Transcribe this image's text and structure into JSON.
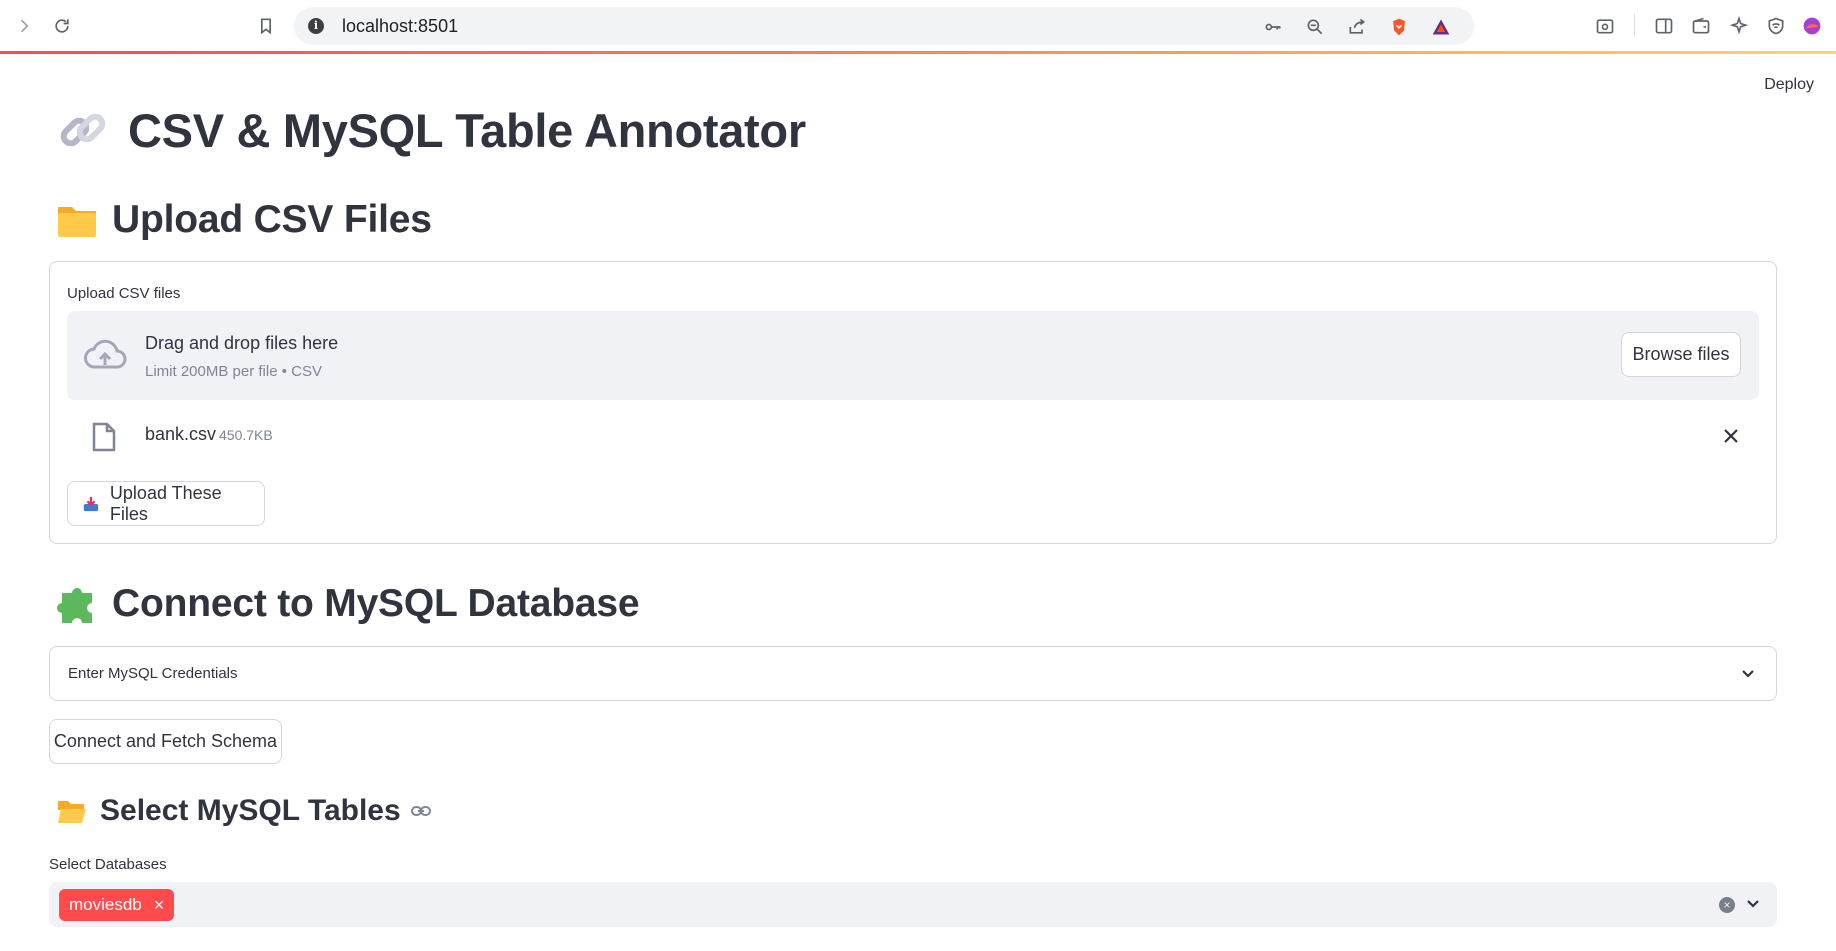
{
  "browser": {
    "url": "localhost:8501"
  },
  "app": {
    "deploy_label": "Deploy",
    "title": "CSV & MySQL Table Annotator",
    "title_icon": "link-emoji"
  },
  "upload_section": {
    "heading": "Upload CSV Files",
    "heading_icon": "folder-emoji",
    "uploader_label": "Upload CSV files",
    "dropzone_title": "Drag and drop files here",
    "dropzone_limit": "Limit 200MB per file • CSV",
    "browse_button": "Browse files",
    "files": [
      {
        "name": "bank.csv",
        "size": "450.7KB"
      }
    ],
    "upload_button": "Upload These Files"
  },
  "mysql_section": {
    "heading": "Connect to MySQL Database",
    "heading_icon": "puzzle-emoji",
    "expander_label": "Enter MySQL Credentials",
    "connect_button": "Connect and Fetch Schema"
  },
  "tables_section": {
    "heading": "Select MySQL Tables",
    "heading_icon": "open-folder-emoji",
    "select_label": "Select Databases",
    "selected": [
      "moviesdb"
    ]
  },
  "colors": {
    "primary": "#ff4b4b",
    "text": "#31333f",
    "muted": "#808495",
    "input_bg": "#f0f2f6",
    "border": "#d6d6d9"
  }
}
